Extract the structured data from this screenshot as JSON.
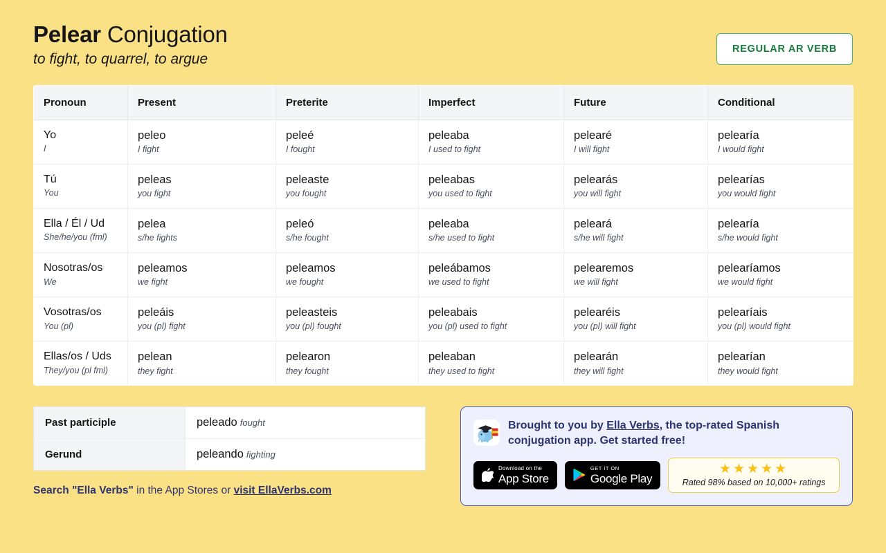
{
  "header": {
    "verb": "Pelear",
    "title_suffix": " Conjugation",
    "subtitle": "to fight, to quarrel, to argue",
    "badge": "REGULAR AR VERB"
  },
  "table": {
    "columns": [
      "Pronoun",
      "Present",
      "Preterite",
      "Imperfect",
      "Future",
      "Conditional"
    ],
    "rows": [
      {
        "pronoun": "Yo",
        "pronoun_gloss": "I",
        "cells": [
          {
            "form": "peleo",
            "gloss": "I fight"
          },
          {
            "form": "peleé",
            "gloss": "I fought"
          },
          {
            "form": "peleaba",
            "gloss": "I used to fight"
          },
          {
            "form": "pelearé",
            "gloss": "I will fight"
          },
          {
            "form": "pelearía",
            "gloss": "I would fight"
          }
        ]
      },
      {
        "pronoun": "Tú",
        "pronoun_gloss": "You",
        "cells": [
          {
            "form": "peleas",
            "gloss": "you fight"
          },
          {
            "form": "peleaste",
            "gloss": "you fought"
          },
          {
            "form": "peleabas",
            "gloss": "you used to fight"
          },
          {
            "form": "pelearás",
            "gloss": "you will fight"
          },
          {
            "form": "pelearías",
            "gloss": "you would fight"
          }
        ]
      },
      {
        "pronoun": "Ella / Él / Ud",
        "pronoun_gloss": "She/he/you (fml)",
        "cells": [
          {
            "form": "pelea",
            "gloss": "s/he fights"
          },
          {
            "form": "peleó",
            "gloss": "s/he fought"
          },
          {
            "form": "peleaba",
            "gloss": "s/he used to fight"
          },
          {
            "form": "peleará",
            "gloss": "s/he will fight"
          },
          {
            "form": "pelearía",
            "gloss": "s/he would fight"
          }
        ]
      },
      {
        "pronoun": "Nosotras/os",
        "pronoun_gloss": "We",
        "cells": [
          {
            "form": "peleamos",
            "gloss": "we fight"
          },
          {
            "form": "peleamos",
            "gloss": "we fought"
          },
          {
            "form": "peleábamos",
            "gloss": "we used to fight"
          },
          {
            "form": "pelearemos",
            "gloss": "we will fight"
          },
          {
            "form": "pelearíamos",
            "gloss": "we would fight"
          }
        ]
      },
      {
        "pronoun": "Vosotras/os",
        "pronoun_gloss": "You (pl)",
        "cells": [
          {
            "form": "peleáis",
            "gloss": "you (pl) fight"
          },
          {
            "form": "peleasteis",
            "gloss": "you (pl) fought"
          },
          {
            "form": "peleabais",
            "gloss": "you (pl) used to fight"
          },
          {
            "form": "pelearéis",
            "gloss": "you (pl) will fight"
          },
          {
            "form": "pelearíais",
            "gloss": "you (pl) would fight"
          }
        ]
      },
      {
        "pronoun": "Ellas/os / Uds",
        "pronoun_gloss": "They/you (pl fml)",
        "cells": [
          {
            "form": "pelean",
            "gloss": "they fight"
          },
          {
            "form": "pelearon",
            "gloss": "they fought"
          },
          {
            "form": "peleaban",
            "gloss": "they used to fight"
          },
          {
            "form": "pelearán",
            "gloss": "they will fight"
          },
          {
            "form": "pelearían",
            "gloss": "they would fight"
          }
        ]
      }
    ]
  },
  "forms": {
    "rows": [
      {
        "label": "Past participle",
        "value": "peleado",
        "gloss": "fought"
      },
      {
        "label": "Gerund",
        "value": "peleando",
        "gloss": "fighting"
      }
    ]
  },
  "search_line": {
    "bold_1": "Search \"Ella Verbs\"",
    "mid": " in the App Stores or ",
    "link": "visit EllaVerbs.com"
  },
  "promo": {
    "text_1": "Brought to you by ",
    "link": "Ella Verbs",
    "text_2": ", the top-rated Spanish conjugation app. Get started free!",
    "app_store": {
      "small": "Download on the",
      "big": "App Store"
    },
    "google_play": {
      "small": "GET IT ON",
      "big": "Google Play"
    },
    "rating": {
      "stars": "★★★★★",
      "text": "Rated 98% based on 10,000+ ratings"
    }
  },
  "colors": {
    "background": "#fae185",
    "badge_green": "#18793c",
    "promo_indigo": "#4f5bd5",
    "star_gold": "#fbbf15"
  }
}
